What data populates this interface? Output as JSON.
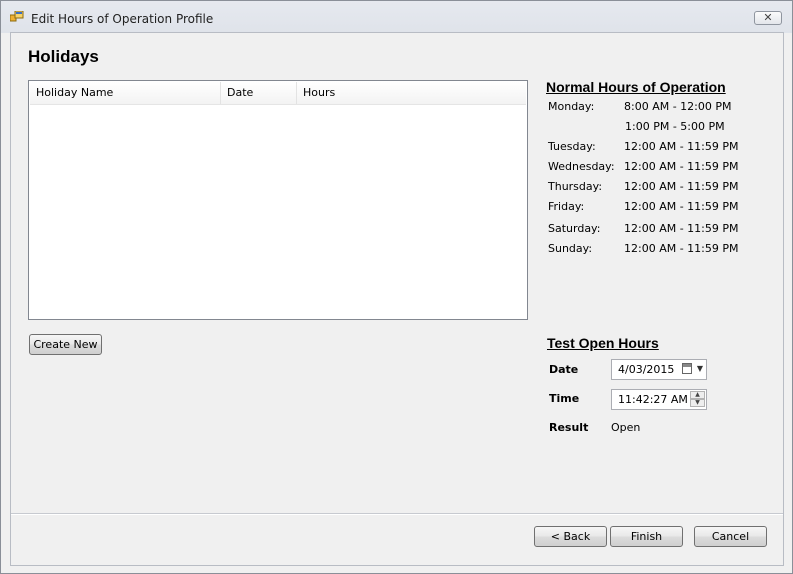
{
  "window": {
    "title": "Edit Hours of Operation Profile",
    "close_glyph": "✕",
    "icon": "app-window-icon"
  },
  "holidays": {
    "heading": "Holidays",
    "columns": [
      "Holiday Name",
      "Date",
      "Hours"
    ],
    "rows": [],
    "create_new_label": "Create New"
  },
  "normal_hours": {
    "title": "Normal Hours of Operation",
    "rows": [
      {
        "day": "Monday:",
        "time": "8:00 AM - 12:00 PM"
      },
      {
        "day": "",
        "time": "1:00 PM - 5:00 PM"
      },
      {
        "day": "Tuesday:",
        "time": "12:00 AM - 11:59 PM"
      },
      {
        "day": "Wednesday:",
        "time": "12:00 AM - 11:59 PM"
      },
      {
        "day": "Thursday:",
        "time": "12:00 AM - 11:59 PM"
      },
      {
        "day": "Friday:",
        "time": "12:00 AM - 11:59 PM"
      },
      {
        "day": "Saturday:",
        "time": "12:00 AM - 11:59 PM"
      },
      {
        "day": "Sunday:",
        "time": "12:00 AM - 11:59 PM"
      }
    ]
  },
  "test_open_hours": {
    "title": "Test Open Hours",
    "date_label": "Date",
    "date_value": "4/03/2015",
    "time_label": "Time",
    "time_value": "11:42:27 AM",
    "result_label": "Result",
    "result_value": "Open"
  },
  "footer": {
    "back_label": "< Back",
    "finish_label": "Finish",
    "cancel_label": "Cancel"
  }
}
